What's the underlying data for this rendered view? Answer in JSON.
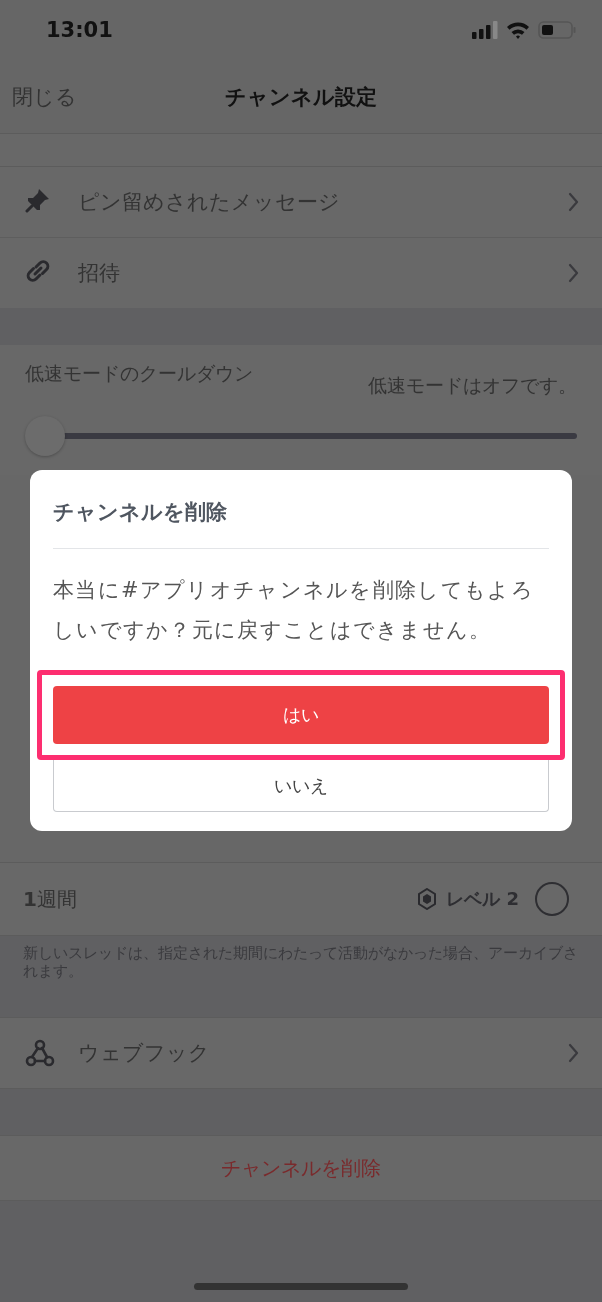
{
  "status_bar": {
    "time": "13:01"
  },
  "nav": {
    "close": "閉じる",
    "title": "チャンネル設定"
  },
  "menu_rows": [
    {
      "kind": "pin",
      "label": "ピン留めされたメッセージ"
    },
    {
      "kind": "link",
      "label": "招待"
    }
  ],
  "slowmode": {
    "label": "低速モードのクールダウン",
    "value": "低速モードはオフです。",
    "level": 0
  },
  "archive_options": [
    {
      "label": "**1**週間",
      "badge": "レベル 2",
      "selected": false
    }
  ],
  "archive_note": "新しいスレッドは、指定された期間にわたって活動がなかった場合、アーカイブされます。",
  "webhook_row": {
    "kind": "webhook",
    "label": "ウェブフック"
  },
  "delete_button": "チャンネルを削除",
  "dialog": {
    "title": "チャンネルを削除",
    "message": "本当に#アプリオチャンネルを削除してもよろしいですか？元に戻すことはできません。",
    "confirm": "はい",
    "cancel": "いいえ",
    "highlighted": true
  }
}
